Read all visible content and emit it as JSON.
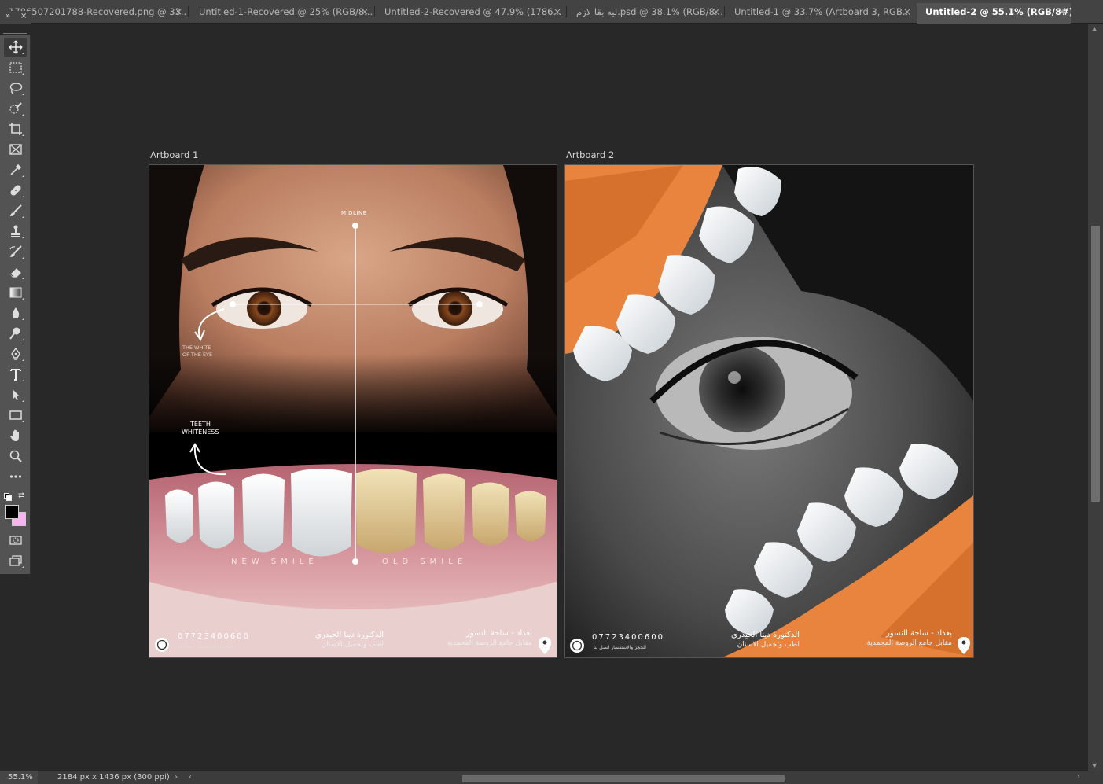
{
  "tabs": [
    {
      "label": "1786507201788-Recovered.png @ 33....",
      "active": false
    },
    {
      "label": "Untitled-1-Recovered @ 25% (RGB/8...",
      "active": false
    },
    {
      "label": "Untitled-2-Recovered @ 47.9% (1786...",
      "active": false
    },
    {
      "label": "ليه بقا لازم.psd @ 38.1% (RGB/8...",
      "active": false
    },
    {
      "label": "Untitled-1 @ 33.7% (Artboard 3, RGB...",
      "active": false
    },
    {
      "label": "Untitled-2 @ 55.1% (RGB/8#) *",
      "active": true
    }
  ],
  "tab_close_glyph": "×",
  "panel_collapse": {
    "expand": "»",
    "close": "×"
  },
  "tools": [
    "move-tool",
    "marquee-tool",
    "lasso-tool",
    "quick-selection-tool",
    "crop-tool",
    "frame-tool",
    "eyedropper-tool",
    "healing-brush-tool",
    "brush-tool",
    "clone-stamp-tool",
    "history-brush-tool",
    "eraser-tool",
    "gradient-tool",
    "blur-tool",
    "dodge-tool",
    "pen-tool",
    "type-tool",
    "path-selection-tool",
    "rectangle-tool",
    "hand-tool",
    "zoom-tool",
    "edit-toolbar"
  ],
  "colors": {
    "foreground": "#000000",
    "background": "#f5b6f0"
  },
  "artboards": [
    {
      "label": "Artboard 1",
      "midline": "MIDLINE",
      "white_of_eye": [
        "THE WHITE",
        "OF THE EYE"
      ],
      "teeth_whiteness": [
        "TEETH",
        "WHITENESS"
      ],
      "new_smile": "NEW SMILE",
      "old_smile": "OLD SMILE",
      "phone": "07723400600",
      "phone_sub": "للحجز والاستفسار اتصل بنا",
      "doctor": "الدكتورة دينا الحيدري",
      "doctor_sub": "لطب وتجميل الاسنان",
      "address": "بغداد - ساحة النسور",
      "address_sub": "مقابل جامع الروضة المحمدية"
    },
    {
      "label": "Artboard 2",
      "phone": "07723400600",
      "phone_sub": "للحجز والاستفسار اتصل بنا",
      "doctor": "الدكتورة دينا الحيدري",
      "doctor_sub": "لطب وتجميل الاسنان",
      "address": "بغداد - ساحة النسور",
      "address_sub": "مقابل جامع الروضة المحمدية"
    }
  ],
  "status": {
    "zoom": "55.1%",
    "doc_info": "2184 px x 1436 px (300 ppi)",
    "expand_glyph": "›",
    "scroll_left": "‹",
    "scroll_right": "›"
  }
}
